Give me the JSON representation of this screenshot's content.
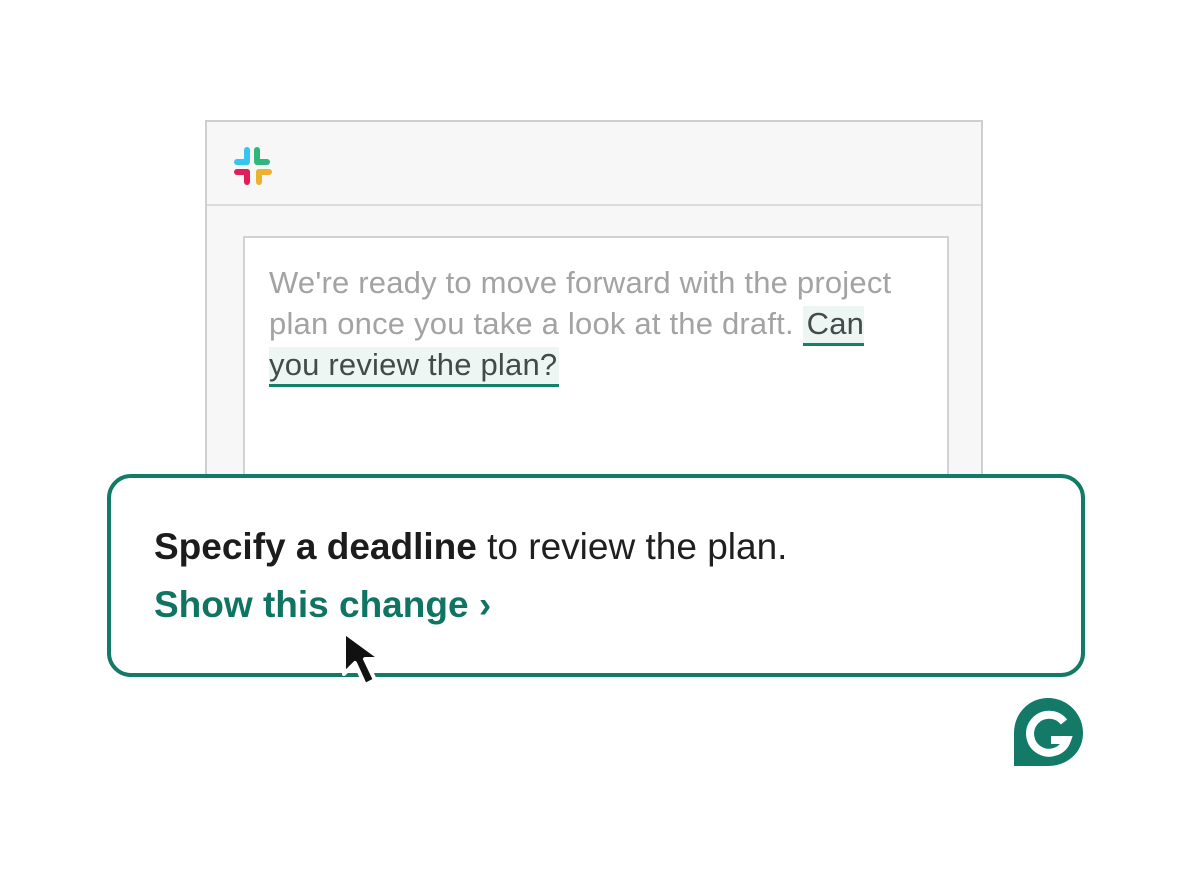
{
  "app": {
    "name": "Slack",
    "logo_icon": "slack-logo-icon"
  },
  "message": {
    "plain_text": "We're ready to move forward with the project plan once you take a look at the draft. ",
    "highlighted_text": "Can you review the plan?"
  },
  "suggestion": {
    "bold_text": "Specify a deadline",
    "rest_text": " to review the plan.",
    "action_label": "Show this change ›"
  },
  "branding": {
    "logo_icon": "grammarly-logo-icon"
  },
  "colors": {
    "accent": "#127a67",
    "link": "#0f7562",
    "highlight_bg": "#eef6f4",
    "placeholder_text": "#a3a3a3",
    "slack_blue": "#36c5f0",
    "slack_green": "#2eb67d",
    "slack_yellow": "#ecb22e",
    "slack_red": "#e01e5a"
  }
}
